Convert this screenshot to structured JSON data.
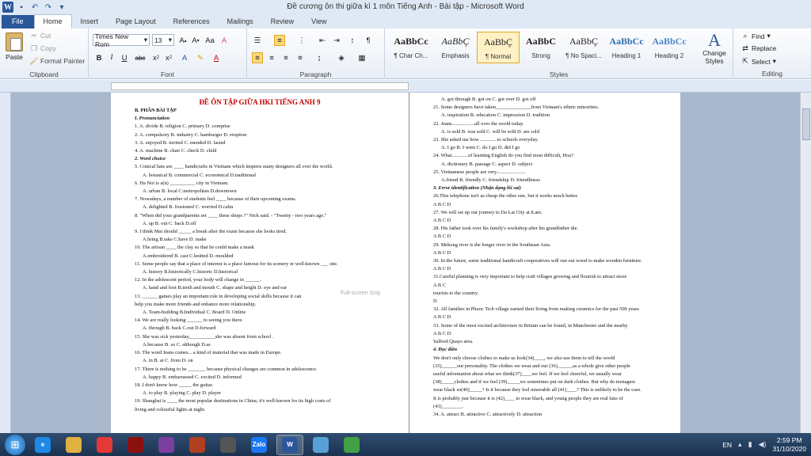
{
  "window": {
    "title": "Đề cương ôn thi giữa kì 1 môn Tiếng Anh - Bài tập  -  Microsoft Word",
    "qa_icons": [
      "word-logo-icon",
      "save-icon",
      "undo-icon",
      "redo-icon",
      "customize-icon"
    ]
  },
  "tabs": [
    "File",
    "Home",
    "Insert",
    "Page Layout",
    "References",
    "Mailings",
    "Review",
    "View"
  ],
  "ribbon": {
    "clipboard": {
      "paste": "Paste",
      "cut": "Cut",
      "copy": "Copy",
      "format_painter": "Format Painter",
      "label": "Clipboard"
    },
    "font": {
      "name": "Times New Rom",
      "size": "13",
      "label": "Font",
      "bold": "B",
      "italic": "I",
      "underline": "U",
      "strike": "abc"
    },
    "paragraph": {
      "label": "Paragraph"
    },
    "styles": {
      "label": "Styles",
      "items": [
        {
          "sample": "AaBbCc",
          "name": "¶ Char Ch..."
        },
        {
          "sample": "AaBbÇ",
          "name": "Emphasis"
        },
        {
          "sample": "AaBbÇ",
          "name": "¶ Normal"
        },
        {
          "sample": "AaBbC",
          "name": "Strong"
        },
        {
          "sample": "AaBbÇ",
          "name": "¶ No Spaci..."
        },
        {
          "sample": "AaBbCc",
          "name": "Heading 1"
        },
        {
          "sample": "AaBbCc",
          "name": "Heading 2"
        }
      ],
      "change_styles": "Change Styles"
    },
    "editing": {
      "find": "Find",
      "replace": "Replace",
      "select": "Select",
      "label": "Editing"
    }
  },
  "snip_label": "Full-screen Snip",
  "page1": {
    "lines": [
      {
        "t": "ĐỀ ÔN TẬP GIỮA HKI TIẾNG ANH 9",
        "c": "heading"
      },
      {
        "t": "B. PHẦN BÀI TẬP",
        "c": "bold"
      },
      {
        "t": "I.    Pronunciation",
        "c": "it"
      },
      {
        "t": "1.      A. divide                  B. religion                C. primary             D. comprise",
        "c": ""
      },
      {
        "t": "2.      A. compulsory          B. industry              C. hamburger         D. eruption",
        "c": ""
      },
      {
        "t": "3.      A. enjoyed                 B. invited                 C. mended              D. lasted",
        "c": ""
      },
      {
        "t": "4.      A. machine               B. chair                    C. check                 D. child",
        "c": ""
      },
      {
        "t": "2.    Word choice",
        "c": "it"
      },
      {
        "t": "5. Conical hats are ____ handicrafts in Vietnam which inspires many designers all over the world.",
        "c": ""
      },
      {
        "t": "A. botanical          B. commercial          C. economical          D.traditional",
        "c": "ind"
      },
      {
        "t": "6. Ha Noi is a(n) __________ city in Vietnam.",
        "c": ""
      },
      {
        "t": "A. urban                B. local                  C.metropolitan          D.downtown",
        "c": "ind"
      },
      {
        "t": "7. Nowadays, a number of students feel ____ because of their upcoming exams.",
        "c": ""
      },
      {
        "t": "A. delighted           B. frustrated            C. worried               D.calm",
        "c": "ind"
      },
      {
        "t": "8. \"When did your grandparents   set ____ these shops ?\" Nick said.    - \"Twenty - two years ago.\"",
        "c": ""
      },
      {
        "t": "A. up                     B. out                     C. back                   D.off",
        "c": "ind"
      },
      {
        "t": "9. I think Mai should _____ a break after the exam because she looks tired.",
        "c": ""
      },
      {
        "t": "A.bring                  B.take                     C.have                    D. make",
        "c": "ind"
      },
      {
        "t": "10. The artisan ____ the clay so that he could make a mask",
        "c": ""
      },
      {
        "t": "A.embroidered        B. cast                    C.knitted                 D. moulded",
        "c": "ind"
      },
      {
        "t": "11. Some people say that a place of interest is a place famous for its scenery or well-known ___ site.",
        "c": ""
      },
      {
        "t": "A. history               B.historically          C.historic                D.historical",
        "c": "ind"
      },
      {
        "t": "12. In the adolescent period, your body will change in ______.",
        "c": ""
      },
      {
        "t": "A. hand and foot     B.teeth and mouth     C. shape and height    D. eye and ear",
        "c": "ind"
      },
      {
        "t": "13. ______ games play an important role in developing social skills because it can",
        "c": ""
      },
      {
        "t": "help you make more friends and enhance more relationship.",
        "c": ""
      },
      {
        "t": "A. Team-building     B.Individual             C. Board                 D. Online",
        "c": "ind"
      },
      {
        "t": "14. We are really looking ______ to seeing you there.",
        "c": ""
      },
      {
        "t": "A. through               B. back                    C.out                      D.forward",
        "c": "ind"
      },
      {
        "t": "15. She was sick yesterday,__________she  was absent from school .",
        "c": ""
      },
      {
        "t": "A.because               B. so                       C. although              D.as",
        "c": "ind"
      },
      {
        "t": "16. The word Jeans comes... a kind of material that was made in Europe.",
        "c": ""
      },
      {
        "t": "A. in                       B. at                       C. from                   D. on",
        "c": "ind"
      },
      {
        "t": "17. There is nothing to be _______ because physical changes are common in adolescence.",
        "c": ""
      },
      {
        "t": "A. happy                 B. embarrassed          C. excited                D. informed",
        "c": "ind"
      },
      {
        "t": "18. I don't know how _____ the guitar.",
        "c": ""
      },
      {
        "t": "A. to play               B. playing                 C. play                   D. player",
        "c": "ind"
      },
      {
        "t": "19. Shanghai is ____ the most popular destinations in China; it's well-known for its high costs of",
        "c": ""
      },
      {
        "t": "living and colourful lights at night.",
        "c": ""
      }
    ]
  },
  "page2": {
    "lines": [
      {
        "t": "A. got through          B. got on                C. got over              D. got off",
        "c": "ind"
      },
      {
        "t": "21. Some designers have taken______________from Vietnam's ethnic minorities.",
        "c": ""
      },
      {
        "t": "A. inspiration          B. education             C. impression           D. tradition",
        "c": "ind"
      },
      {
        "t": "22. Jeans..................all over the world today.",
        "c": ""
      },
      {
        "t": "A. is sold                 B. was sold               C. will be sold          D. are sold",
        "c": "ind"
      },
      {
        "t": "23. She asked me how...............to schools everyday.",
        "c": ""
      },
      {
        "t": "A. I go                     B. I went                   C. do I go                D. did I go",
        "c": "ind"
      },
      {
        "t": "24. What.............of learning English do you find most difficult, Hoa?",
        "c": ""
      },
      {
        "t": "A. dictionary            B. passage                C. aspect                  D. subject",
        "c": "ind"
      },
      {
        "t": "25. Vietnamese people are very.......................",
        "c": ""
      },
      {
        "t": "A.friend                  B. friendly                 C. friendship             D. friendliness",
        "c": "ind"
      },
      {
        "t": "3.    Error identification (Nhận dạng lỗi sai)",
        "c": "it"
      },
      {
        "t": "26.This telephone isn't as cheap the other one, but it works much better.",
        "c": ""
      },
      {
        "t": "                        A              B                       C        D",
        "c": ""
      },
      {
        "t": "27. We will set up our journey to Da Lat City at 8.am.",
        "c": ""
      },
      {
        "t": "                     A          B         C        D",
        "c": ""
      },
      {
        "t": "28. His father took over his family's workshop after his grandfather die.",
        "c": ""
      },
      {
        "t": "                     A                 B                      C                        D",
        "c": ""
      },
      {
        "t": "29. Mekong river is the longer river in the Southeast Asia.",
        "c": ""
      },
      {
        "t": "               A              B       C     D",
        "c": ""
      },
      {
        "t": "30. In the future, some traditional handicraft cooperatives will run out wood to make wooden furniture.",
        "c": ""
      },
      {
        "t": "            A                                         B               C                        D",
        "c": ""
      },
      {
        "t": "31.Careful planning is very important to help craft villages growing and flourish to attract more",
        "c": ""
      },
      {
        "t": "            A                                                              B                        C",
        "c": ""
      },
      {
        "t": "tourists to the country.",
        "c": ""
      },
      {
        "t": "               D",
        "c": ""
      },
      {
        "t": "32. All families in Phuoc Tich village earned their living from making ceramics for the past 500 years",
        "c": ""
      },
      {
        "t": "         A                                        B                C                              D",
        "c": ""
      },
      {
        "t": "33. Some of the most excited architecture in Britain can be found, in Manchester and the nearby",
        "c": ""
      },
      {
        "t": "                A                        B                                C                       D",
        "c": ""
      },
      {
        "t": "Salford Quays  area.",
        "c": ""
      },
      {
        "t": "4.    Đọc điền",
        "c": "it"
      },
      {
        "t": "We don't only choose clothes to make us look(34)____, we also use them to tell the world",
        "c": ""
      },
      {
        "t": "(35)______our personality. The clothes we wear and our (36)______as a whole give other people",
        "c": ""
      },
      {
        "t": "useful information about what we think(37)____we feel. If we feel cheerful, we usually wear",
        "c": ""
      },
      {
        "t": "(38)_____clothes and if we feel (39)_____we sometimes put on dark clothes. But why do teenagers",
        "c": ""
      },
      {
        "t": "wear black so(40)_____? Is it because they feel miserable all (41)____? This is unlikely to be the case.",
        "c": ""
      },
      {
        "t": "It is probably just because it is (42)____ to wear black, and young people they are real fans of",
        "c": ""
      },
      {
        "t": "(43)________.",
        "c": ""
      },
      {
        "t": "34. A. attract             B. attractive             C. attractively           D. attraction",
        "c": ""
      }
    ]
  },
  "taskbar": {
    "apps": [
      {
        "name": "ie-icon",
        "color": "#1e88e5",
        "label": "e"
      },
      {
        "name": "explorer-icon",
        "color": "#e0b040",
        "label": ""
      },
      {
        "name": "chrome-icon",
        "color": "#e53935",
        "label": ""
      },
      {
        "name": "game-icon",
        "color": "#8b1010",
        "label": ""
      },
      {
        "name": "winrar-icon",
        "color": "#7b3fa0",
        "label": ""
      },
      {
        "name": "game2-icon",
        "color": "#b04020",
        "label": ""
      },
      {
        "name": "audio-icon",
        "color": "#555",
        "label": ""
      },
      {
        "name": "zalo-icon",
        "color": "#1a78f2",
        "label": "Zalo"
      },
      {
        "name": "word-icon",
        "color": "#2b579a",
        "label": "W"
      },
      {
        "name": "paint-icon",
        "color": "#5aa0d8",
        "label": ""
      },
      {
        "name": "chrome2-icon",
        "color": "#43a047",
        "label": ""
      }
    ],
    "lang": "EN",
    "time": "2:59 PM",
    "date": "31/10/2020"
  }
}
